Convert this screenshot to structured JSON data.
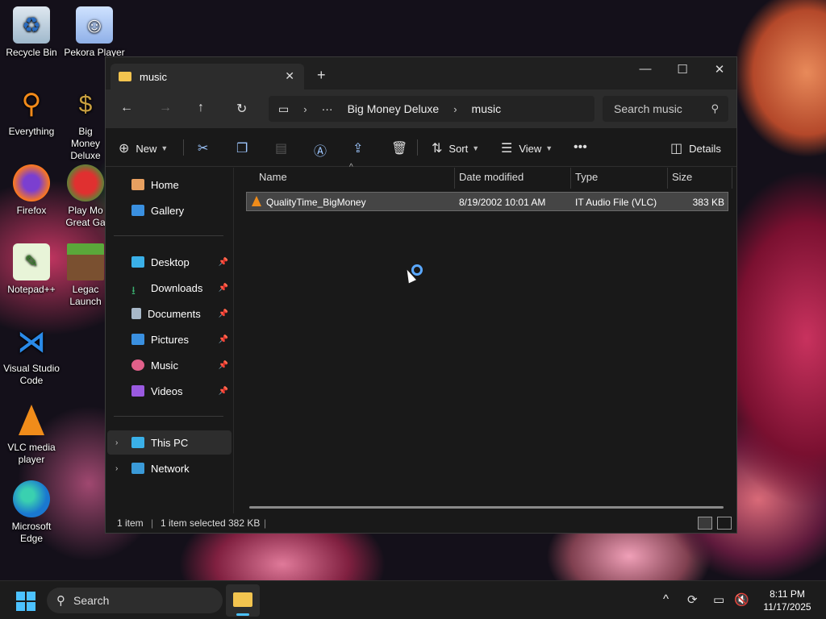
{
  "desktop": {
    "icons": [
      {
        "label": "Recycle Bin"
      },
      {
        "label": "Pekora Player"
      },
      {
        "label": "Everything"
      },
      {
        "label": "Big Money Deluxe"
      },
      {
        "label": "Firefox"
      },
      {
        "label": "Play Mo Great Ga"
      },
      {
        "label": "Notepad++"
      },
      {
        "label": "Legac Launch"
      },
      {
        "label": "Visual Studio Code"
      },
      {
        "label": "VLC media player"
      },
      {
        "label": "Microsoft Edge"
      }
    ]
  },
  "window": {
    "tab_title": "music",
    "breadcrumb": [
      "Big Money Deluxe",
      "music"
    ],
    "search_placeholder": "Search music",
    "toolbar": {
      "new_label": "New",
      "sort_label": "Sort",
      "view_label": "View",
      "details_label": "Details"
    },
    "sidebar": {
      "home": "Home",
      "gallery": "Gallery",
      "desktop": "Desktop",
      "downloads": "Downloads",
      "documents": "Documents",
      "pictures": "Pictures",
      "music": "Music",
      "videos": "Videos",
      "this_pc": "This PC",
      "network": "Network"
    },
    "columns": {
      "name": "Name",
      "date": "Date modified",
      "type": "Type",
      "size": "Size"
    },
    "files": [
      {
        "name": "QualityTime_BigMoney",
        "date": "8/19/2002 10:01 AM",
        "type": "IT Audio File (VLC)",
        "size": "383 KB"
      }
    ],
    "status": {
      "count": "1 item",
      "selected": "1 item selected",
      "size": "382 KB"
    }
  },
  "taskbar": {
    "search_label": "Search",
    "time": "8:11 PM",
    "date": "11/17/2025"
  },
  "colors": {
    "accent": "#4cc2ff",
    "folder": "#f3c44f",
    "vlc": "#f08c1a"
  }
}
